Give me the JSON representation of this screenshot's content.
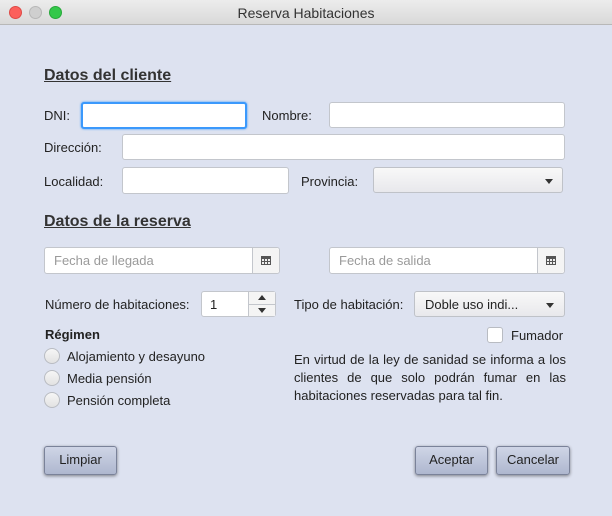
{
  "window": {
    "title": "Reserva Habitaciones"
  },
  "client_section": {
    "heading": "Datos del cliente",
    "dni_label": "DNI:",
    "dni_value": "",
    "nombre_label": "Nombre:",
    "nombre_value": "",
    "direccion_label": "Dirección:",
    "direccion_value": "",
    "localidad_label": "Localidad:",
    "localidad_value": "",
    "provincia_label": "Provincia:",
    "provincia_value": ""
  },
  "reservation_section": {
    "heading": "Datos de la reserva",
    "arrival_placeholder": "Fecha de llegada",
    "departure_placeholder": "Fecha de salida",
    "rooms_label": "Número de habitaciones:",
    "rooms_value": "1",
    "room_type_label": "Tipo de habitación:",
    "room_type_value": "Doble uso indi...",
    "smoker_label": "Fumador",
    "regime_heading": "Régimen",
    "regime_options": [
      "Alojamiento y desayuno",
      "Media pensión",
      "Pensión completa"
    ],
    "info_text": "En virtud de la ley de sanidad se informa a los clientes de que solo podrán fumar en las habitaciones reservadas para tal fin."
  },
  "buttons": {
    "clear": "Limpiar",
    "accept": "Aceptar",
    "cancel": "Cancelar"
  }
}
